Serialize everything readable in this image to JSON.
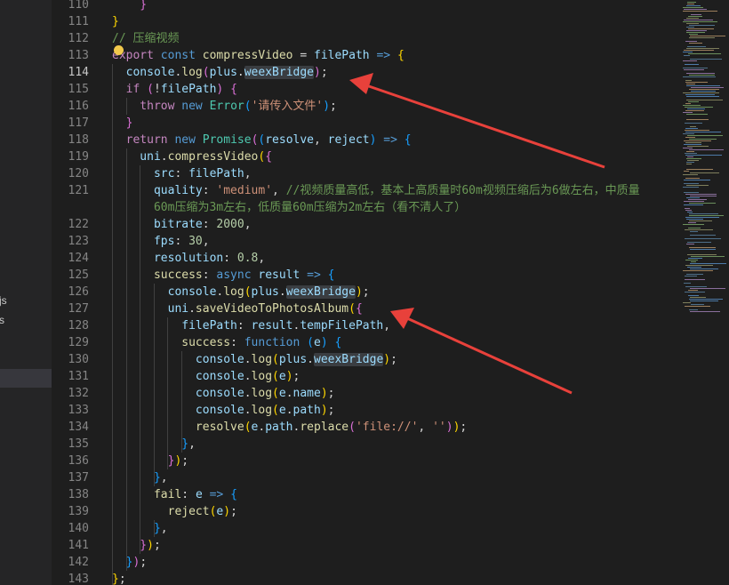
{
  "sidebar": {
    "items": [
      {
        "label": "js"
      },
      {
        "label": "s"
      },
      {
        "label": ""
      }
    ]
  },
  "editor": {
    "active_line": 114,
    "lines": [
      {
        "num": "110",
        "tokens": [
          {
            "t": "    }",
            "c": "#da70d6"
          }
        ]
      },
      {
        "num": "111",
        "tokens": [
          {
            "t": "}",
            "c": "#ffd700"
          }
        ]
      },
      {
        "num": "112",
        "tokens": [
          {
            "t": "// 压缩视频",
            "c": "#6a9955"
          }
        ]
      },
      {
        "num": "113",
        "tokens": [
          {
            "t": "export ",
            "c": "#c586c0"
          },
          {
            "t": "const ",
            "c": "#569cd6"
          },
          {
            "t": "compressVideo",
            "c": "#dcdcaa"
          },
          {
            "t": " = ",
            "c": "#d4d4d4"
          },
          {
            "t": "filePath",
            "c": "#9cdcfe"
          },
          {
            "t": " => ",
            "c": "#569cd6"
          },
          {
            "t": "{",
            "c": "#ffd700"
          }
        ]
      },
      {
        "num": "114",
        "tokens": [
          {
            "t": "  console",
            "c": "#9cdcfe"
          },
          {
            "t": ".",
            "c": "#d4d4d4"
          },
          {
            "t": "log",
            "c": "#dcdcaa"
          },
          {
            "t": "(",
            "c": "#da70d6"
          },
          {
            "t": "plus",
            "c": "#9cdcfe"
          },
          {
            "t": ".",
            "c": "#d4d4d4"
          },
          {
            "t": "weexBridge",
            "c": "#9cdcfe",
            "hl": true
          },
          {
            "t": ")",
            "c": "#da70d6"
          },
          {
            "t": ";",
            "c": "#d4d4d4"
          }
        ]
      },
      {
        "num": "115",
        "tokens": [
          {
            "t": "  if ",
            "c": "#c586c0"
          },
          {
            "t": "(",
            "c": "#da70d6"
          },
          {
            "t": "!",
            "c": "#d4d4d4"
          },
          {
            "t": "filePath",
            "c": "#9cdcfe"
          },
          {
            "t": ") ",
            "c": "#da70d6"
          },
          {
            "t": "{",
            "c": "#da70d6"
          }
        ]
      },
      {
        "num": "116",
        "tokens": [
          {
            "t": "    throw ",
            "c": "#c586c0"
          },
          {
            "t": "new ",
            "c": "#569cd6"
          },
          {
            "t": "Error",
            "c": "#4ec9b0"
          },
          {
            "t": "(",
            "c": "#179fff"
          },
          {
            "t": "'请传入文件'",
            "c": "#ce9178"
          },
          {
            "t": ")",
            "c": "#179fff"
          },
          {
            "t": ";",
            "c": "#d4d4d4"
          }
        ]
      },
      {
        "num": "117",
        "tokens": [
          {
            "t": "  }",
            "c": "#da70d6"
          }
        ]
      },
      {
        "num": "118",
        "tokens": [
          {
            "t": "  return ",
            "c": "#c586c0"
          },
          {
            "t": "new ",
            "c": "#569cd6"
          },
          {
            "t": "Promise",
            "c": "#4ec9b0"
          },
          {
            "t": "(",
            "c": "#da70d6"
          },
          {
            "t": "(",
            "c": "#179fff"
          },
          {
            "t": "resolve",
            "c": "#9cdcfe"
          },
          {
            "t": ", ",
            "c": "#d4d4d4"
          },
          {
            "t": "reject",
            "c": "#9cdcfe"
          },
          {
            "t": ")",
            "c": "#179fff"
          },
          {
            "t": " => ",
            "c": "#569cd6"
          },
          {
            "t": "{",
            "c": "#179fff"
          }
        ]
      },
      {
        "num": "119",
        "tokens": [
          {
            "t": "    uni",
            "c": "#9cdcfe"
          },
          {
            "t": ".",
            "c": "#d4d4d4"
          },
          {
            "t": "compressVideo",
            "c": "#dcdcaa"
          },
          {
            "t": "(",
            "c": "#ffd700"
          },
          {
            "t": "{",
            "c": "#da70d6"
          }
        ]
      },
      {
        "num": "120",
        "tokens": [
          {
            "t": "      src",
            "c": "#9cdcfe"
          },
          {
            "t": ": ",
            "c": "#d4d4d4"
          },
          {
            "t": "filePath",
            "c": "#9cdcfe"
          },
          {
            "t": ",",
            "c": "#d4d4d4"
          }
        ]
      },
      {
        "num": "121",
        "tokens": [
          {
            "t": "      quality",
            "c": "#9cdcfe"
          },
          {
            "t": ": ",
            "c": "#d4d4d4"
          },
          {
            "t": "'medium'",
            "c": "#ce9178"
          },
          {
            "t": ", ",
            "c": "#d4d4d4"
          },
          {
            "t": "//视频质量高低，基本上高质量时60m视频压缩后为6做左右，中质量",
            "c": "#6a9955"
          }
        ]
      },
      {
        "num": "",
        "tokens": [
          {
            "t": "      60m压缩为3m左右，低质量60m压缩为2m左右（看不清人了）",
            "c": "#6a9955"
          }
        ]
      },
      {
        "num": "122",
        "tokens": [
          {
            "t": "      bitrate",
            "c": "#9cdcfe"
          },
          {
            "t": ": ",
            "c": "#d4d4d4"
          },
          {
            "t": "2000",
            "c": "#b5cea8"
          },
          {
            "t": ",",
            "c": "#d4d4d4"
          }
        ]
      },
      {
        "num": "123",
        "tokens": [
          {
            "t": "      fps",
            "c": "#9cdcfe"
          },
          {
            "t": ": ",
            "c": "#d4d4d4"
          },
          {
            "t": "30",
            "c": "#b5cea8"
          },
          {
            "t": ",",
            "c": "#d4d4d4"
          }
        ]
      },
      {
        "num": "124",
        "tokens": [
          {
            "t": "      resolution",
            "c": "#9cdcfe"
          },
          {
            "t": ": ",
            "c": "#d4d4d4"
          },
          {
            "t": "0.8",
            "c": "#b5cea8"
          },
          {
            "t": ",",
            "c": "#d4d4d4"
          }
        ]
      },
      {
        "num": "125",
        "tokens": [
          {
            "t": "      success",
            "c": "#dcdcaa"
          },
          {
            "t": ": ",
            "c": "#d4d4d4"
          },
          {
            "t": "async ",
            "c": "#569cd6"
          },
          {
            "t": "result",
            "c": "#9cdcfe"
          },
          {
            "t": " => ",
            "c": "#569cd6"
          },
          {
            "t": "{",
            "c": "#179fff"
          }
        ]
      },
      {
        "num": "126",
        "tokens": [
          {
            "t": "        console",
            "c": "#9cdcfe"
          },
          {
            "t": ".",
            "c": "#d4d4d4"
          },
          {
            "t": "log",
            "c": "#dcdcaa"
          },
          {
            "t": "(",
            "c": "#ffd700"
          },
          {
            "t": "plus",
            "c": "#9cdcfe"
          },
          {
            "t": ".",
            "c": "#d4d4d4"
          },
          {
            "t": "weexBridge",
            "c": "#9cdcfe",
            "hl": true
          },
          {
            "t": ")",
            "c": "#ffd700"
          },
          {
            "t": ";",
            "c": "#d4d4d4"
          }
        ]
      },
      {
        "num": "127",
        "tokens": [
          {
            "t": "        uni",
            "c": "#9cdcfe"
          },
          {
            "t": ".",
            "c": "#d4d4d4"
          },
          {
            "t": "saveVideoToPhotosAlbum",
            "c": "#dcdcaa"
          },
          {
            "t": "(",
            "c": "#ffd700"
          },
          {
            "t": "{",
            "c": "#da70d6"
          }
        ]
      },
      {
        "num": "128",
        "tokens": [
          {
            "t": "          filePath",
            "c": "#9cdcfe"
          },
          {
            "t": ": ",
            "c": "#d4d4d4"
          },
          {
            "t": "result",
            "c": "#9cdcfe"
          },
          {
            "t": ".",
            "c": "#d4d4d4"
          },
          {
            "t": "tempFilePath",
            "c": "#9cdcfe"
          },
          {
            "t": ",",
            "c": "#d4d4d4"
          }
        ]
      },
      {
        "num": "129",
        "tokens": [
          {
            "t": "          success",
            "c": "#dcdcaa"
          },
          {
            "t": ": ",
            "c": "#d4d4d4"
          },
          {
            "t": "function ",
            "c": "#569cd6"
          },
          {
            "t": "(",
            "c": "#179fff"
          },
          {
            "t": "e",
            "c": "#9cdcfe"
          },
          {
            "t": ") ",
            "c": "#179fff"
          },
          {
            "t": "{",
            "c": "#179fff"
          }
        ]
      },
      {
        "num": "130",
        "tokens": [
          {
            "t": "            console",
            "c": "#9cdcfe"
          },
          {
            "t": ".",
            "c": "#d4d4d4"
          },
          {
            "t": "log",
            "c": "#dcdcaa"
          },
          {
            "t": "(",
            "c": "#ffd700"
          },
          {
            "t": "plus",
            "c": "#9cdcfe"
          },
          {
            "t": ".",
            "c": "#d4d4d4"
          },
          {
            "t": "weexBridge",
            "c": "#9cdcfe",
            "hl": true
          },
          {
            "t": ")",
            "c": "#ffd700"
          },
          {
            "t": ";",
            "c": "#d4d4d4"
          }
        ]
      },
      {
        "num": "131",
        "tokens": [
          {
            "t": "            console",
            "c": "#9cdcfe"
          },
          {
            "t": ".",
            "c": "#d4d4d4"
          },
          {
            "t": "log",
            "c": "#dcdcaa"
          },
          {
            "t": "(",
            "c": "#ffd700"
          },
          {
            "t": "e",
            "c": "#9cdcfe"
          },
          {
            "t": ")",
            "c": "#ffd700"
          },
          {
            "t": ";",
            "c": "#d4d4d4"
          }
        ]
      },
      {
        "num": "132",
        "tokens": [
          {
            "t": "            console",
            "c": "#9cdcfe"
          },
          {
            "t": ".",
            "c": "#d4d4d4"
          },
          {
            "t": "log",
            "c": "#dcdcaa"
          },
          {
            "t": "(",
            "c": "#ffd700"
          },
          {
            "t": "e",
            "c": "#9cdcfe"
          },
          {
            "t": ".",
            "c": "#d4d4d4"
          },
          {
            "t": "name",
            "c": "#9cdcfe"
          },
          {
            "t": ")",
            "c": "#ffd700"
          },
          {
            "t": ";",
            "c": "#d4d4d4"
          }
        ]
      },
      {
        "num": "133",
        "tokens": [
          {
            "t": "            console",
            "c": "#9cdcfe"
          },
          {
            "t": ".",
            "c": "#d4d4d4"
          },
          {
            "t": "log",
            "c": "#dcdcaa"
          },
          {
            "t": "(",
            "c": "#ffd700"
          },
          {
            "t": "e",
            "c": "#9cdcfe"
          },
          {
            "t": ".",
            "c": "#d4d4d4"
          },
          {
            "t": "path",
            "c": "#9cdcfe"
          },
          {
            "t": ")",
            "c": "#ffd700"
          },
          {
            "t": ";",
            "c": "#d4d4d4"
          }
        ]
      },
      {
        "num": "134",
        "tokens": [
          {
            "t": "            resolve",
            "c": "#dcdcaa"
          },
          {
            "t": "(",
            "c": "#ffd700"
          },
          {
            "t": "e",
            "c": "#9cdcfe"
          },
          {
            "t": ".",
            "c": "#d4d4d4"
          },
          {
            "t": "path",
            "c": "#9cdcfe"
          },
          {
            "t": ".",
            "c": "#d4d4d4"
          },
          {
            "t": "replace",
            "c": "#dcdcaa"
          },
          {
            "t": "(",
            "c": "#da70d6"
          },
          {
            "t": "'file://'",
            "c": "#ce9178"
          },
          {
            "t": ", ",
            "c": "#d4d4d4"
          },
          {
            "t": "''",
            "c": "#ce9178"
          },
          {
            "t": ")",
            "c": "#da70d6"
          },
          {
            "t": ")",
            "c": "#ffd700"
          },
          {
            "t": ";",
            "c": "#d4d4d4"
          }
        ]
      },
      {
        "num": "135",
        "tokens": [
          {
            "t": "          }",
            "c": "#179fff"
          },
          {
            "t": ",",
            "c": "#d4d4d4"
          }
        ]
      },
      {
        "num": "136",
        "tokens": [
          {
            "t": "        }",
            "c": "#da70d6"
          },
          {
            "t": ")",
            "c": "#ffd700"
          },
          {
            "t": ";",
            "c": "#d4d4d4"
          }
        ]
      },
      {
        "num": "137",
        "tokens": [
          {
            "t": "      }",
            "c": "#179fff"
          },
          {
            "t": ",",
            "c": "#d4d4d4"
          }
        ]
      },
      {
        "num": "138",
        "tokens": [
          {
            "t": "      fail",
            "c": "#dcdcaa"
          },
          {
            "t": ": ",
            "c": "#d4d4d4"
          },
          {
            "t": "e",
            "c": "#9cdcfe"
          },
          {
            "t": " => ",
            "c": "#569cd6"
          },
          {
            "t": "{",
            "c": "#179fff"
          }
        ]
      },
      {
        "num": "139",
        "tokens": [
          {
            "t": "        reject",
            "c": "#dcdcaa"
          },
          {
            "t": "(",
            "c": "#ffd700"
          },
          {
            "t": "e",
            "c": "#9cdcfe"
          },
          {
            "t": ")",
            "c": "#ffd700"
          },
          {
            "t": ";",
            "c": "#d4d4d4"
          }
        ]
      },
      {
        "num": "140",
        "tokens": [
          {
            "t": "      }",
            "c": "#179fff"
          },
          {
            "t": ",",
            "c": "#d4d4d4"
          }
        ]
      },
      {
        "num": "141",
        "tokens": [
          {
            "t": "    }",
            "c": "#da70d6"
          },
          {
            "t": ")",
            "c": "#ffd700"
          },
          {
            "t": ";",
            "c": "#d4d4d4"
          }
        ]
      },
      {
        "num": "142",
        "tokens": [
          {
            "t": "  }",
            "c": "#179fff"
          },
          {
            "t": ")",
            "c": "#da70d6"
          },
          {
            "t": ";",
            "c": "#d4d4d4"
          }
        ]
      },
      {
        "num": "143",
        "tokens": [
          {
            "t": "}",
            "c": "#ffd700"
          },
          {
            "t": ";",
            "c": "#d4d4d4"
          }
        ]
      }
    ]
  },
  "colors": {
    "background": "#1e1e1e",
    "sidebar": "#252526",
    "arrow": "#e8413b",
    "highlight": "#3a3d41"
  }
}
